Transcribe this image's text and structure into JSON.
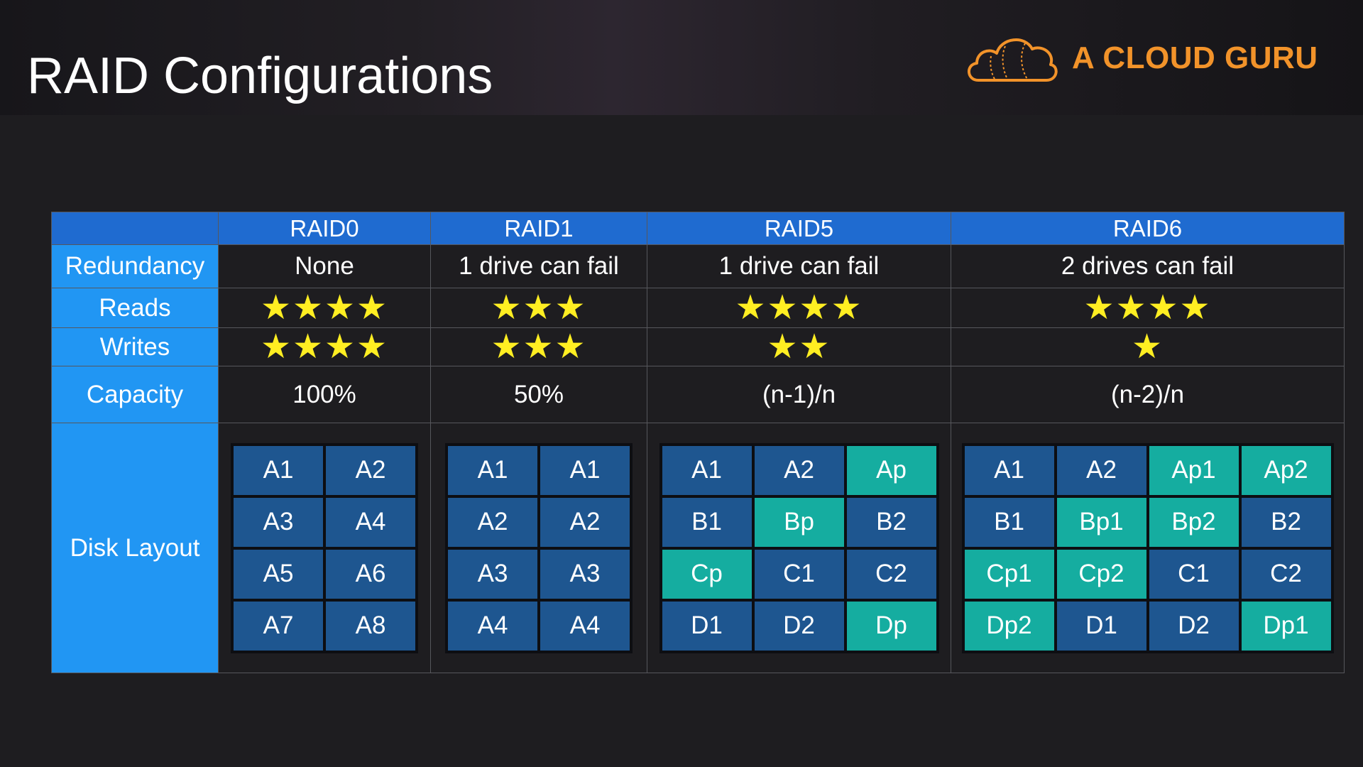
{
  "header": {
    "title": "RAID Configurations",
    "brand": "A CLOUD GURU",
    "brand_icon": "cloud-icon"
  },
  "colors": {
    "header_row": "#1f6bd0",
    "label_column": "#2196f3",
    "data_block": "#1e5690",
    "parity_block": "#15ada0",
    "star": "#ffee22",
    "brand": "#f2932a"
  },
  "table": {
    "corner": "",
    "columns": [
      "RAID0",
      "RAID1",
      "RAID5",
      "RAID6"
    ],
    "rows": {
      "redundancy": {
        "label": "Redundancy",
        "values": [
          "None",
          "1 drive can fail",
          "1 drive can fail",
          "2 drives can fail"
        ]
      },
      "reads": {
        "label": "Reads",
        "stars": [
          4,
          3,
          4,
          4
        ]
      },
      "writes": {
        "label": "Writes",
        "stars": [
          4,
          3,
          2,
          1
        ]
      },
      "capacity": {
        "label": "Capacity",
        "values": [
          "100%",
          "50%",
          "(n-1)/n",
          "(n-2)/n"
        ]
      },
      "disk_layout": {
        "label": "Disk Layout"
      }
    },
    "layouts": [
      {
        "name": "RAID0",
        "cols": 2,
        "blocks": [
          "A1",
          "A2",
          "A3",
          "A4",
          "A5",
          "A6",
          "A7",
          "A8"
        ],
        "parity": []
      },
      {
        "name": "RAID1",
        "cols": 2,
        "blocks": [
          "A1",
          "A1",
          "A2",
          "A2",
          "A3",
          "A3",
          "A4",
          "A4"
        ],
        "parity": []
      },
      {
        "name": "RAID5",
        "cols": 3,
        "blocks": [
          "A1",
          "A2",
          "Ap",
          "B1",
          "Bp",
          "B2",
          "Cp",
          "C1",
          "C2",
          "D1",
          "D2",
          "Dp"
        ],
        "parity": [
          "Ap",
          "Bp",
          "Cp",
          "Dp"
        ]
      },
      {
        "name": "RAID6",
        "cols": 4,
        "blocks": [
          "A1",
          "A2",
          "Ap1",
          "Ap2",
          "B1",
          "Bp1",
          "Bp2",
          "B2",
          "Cp1",
          "Cp2",
          "C1",
          "C2",
          "Dp2",
          "D1",
          "D2",
          "Dp1"
        ],
        "parity": [
          "Ap1",
          "Ap2",
          "Bp1",
          "Bp2",
          "Cp1",
          "Cp2",
          "Dp1",
          "Dp2"
        ]
      }
    ]
  }
}
